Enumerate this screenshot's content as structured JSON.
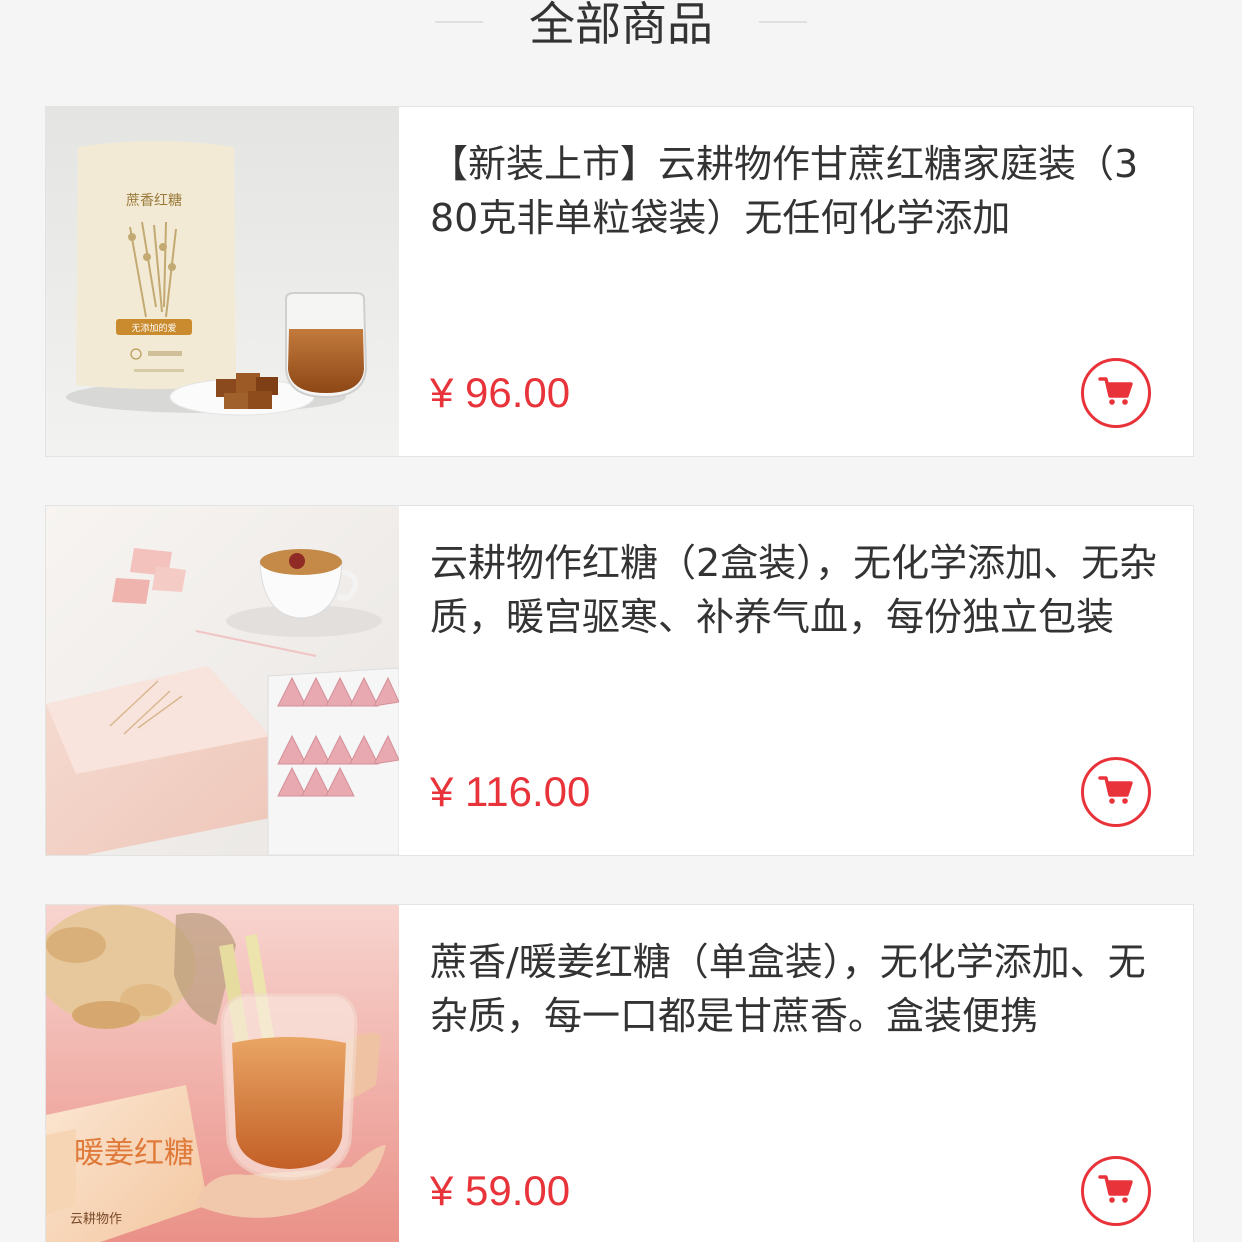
{
  "section": {
    "title": "全部商品"
  },
  "products": [
    {
      "title": "【新装上市】云耕物作甘蔗红糖家庭装（380克非单粒袋装）无任何化学添加",
      "price": "¥ 96.00",
      "image_label": "蔗香红糖",
      "image_tag": "无添加的爱"
    },
    {
      "title": "云耕物作红糖（2盒装），无化学添加、无杂质，暖宫驱寒、补养气血，每份独立包装",
      "price": "¥ 116.00"
    },
    {
      "title": "蔗香/暖姜红糖（单盒装），无化学添加、无杂质，每一口都是甘蔗香。盒装便携",
      "price": "¥ 59.00",
      "image_label": "暖姜红糖",
      "image_brand": "云耕物作"
    }
  ],
  "icons": {
    "cart": "shopping-cart-icon"
  },
  "colors": {
    "accent": "#e8333a",
    "background": "#f5f5f5",
    "text": "#333333"
  }
}
